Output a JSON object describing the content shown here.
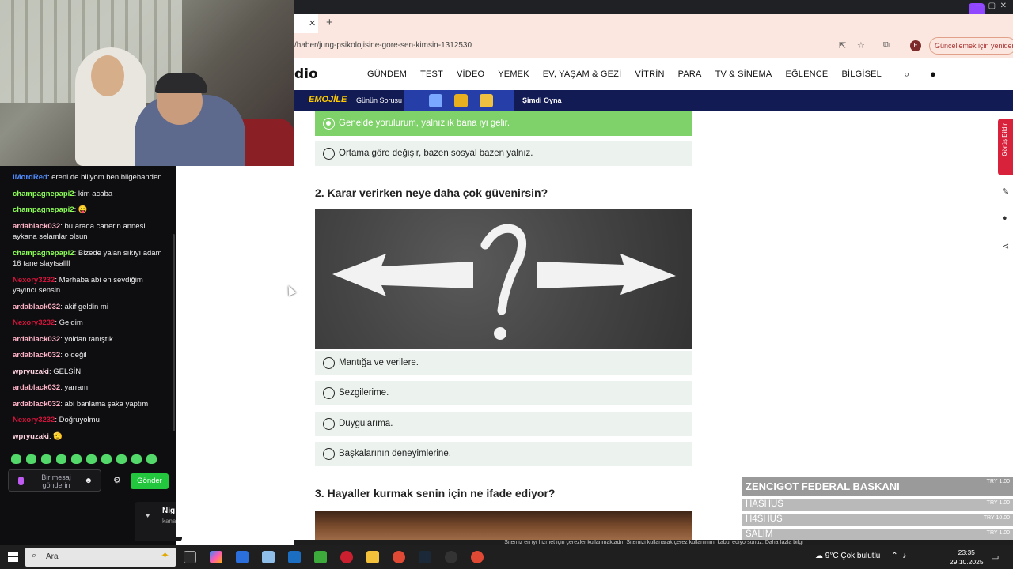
{
  "chat": {
    "messages": [
      {
        "user": "IMordRed",
        "color": "#4f8bff",
        "text": "ereni de biliyom ben bilgehanden"
      },
      {
        "user": "champagnepapi2",
        "color": "#8cff57",
        "text": "kim acaba"
      },
      {
        "user": "champagnepapi2",
        "color": "#8cff57",
        "text": "😛"
      },
      {
        "user": "ardablack032",
        "color": "#ffb3c6",
        "text": "bu arada canerin annesi aykana selamlar olsun"
      },
      {
        "user": "champagnepapi2",
        "color": "#8cff57",
        "text": "Bizede yalan sıkıyı adam 16 tane slaytsallll"
      },
      {
        "user": "Nexory3232",
        "color": "#d4153c",
        "text": "Merhaba abi en sevdiğim yayıncı sensin"
      },
      {
        "user": "ardablack032",
        "color": "#ffb3c6",
        "text": "akif geldin mi"
      },
      {
        "user": "Nexory3232",
        "color": "#d4153c",
        "text": "Geldim"
      },
      {
        "user": "ardablack032",
        "color": "#ffb3c6",
        "text": "yoldan tanıştık"
      },
      {
        "user": "ardablack032",
        "color": "#ffb3c6",
        "text": "o değil"
      },
      {
        "user": "wpryuzaki",
        "color": "#ffd3e0",
        "text": "GELSİN"
      },
      {
        "user": "ardablack032",
        "color": "#ffb3c6",
        "text": "yarram"
      },
      {
        "user": "ardablack032",
        "color": "#ffb3c6",
        "text": "abi banlama şaka yaptım"
      },
      {
        "user": "Nexory3232",
        "color": "#d4153c",
        "text": "Doğruyolmu"
      },
      {
        "user": "wpryuzaki",
        "color": "#ffd3e0",
        "text": "🫡"
      }
    ],
    "input_placeholder": "Bir mesaj gönderin",
    "send_label": "Gönder",
    "notif_title": "Nig",
    "notif_sub": "kana"
  },
  "browser": {
    "url": "/haber/jung-psikolojisine-gore-sen-kimsin-1312530",
    "update_label": "Güncellemek için yeniden başlat",
    "profile_initial": "E"
  },
  "site": {
    "logo": "dio",
    "nav": [
      "GÜNDEM",
      "TEST",
      "VİDEO",
      "YEMEK",
      "EV, YAŞAM & GEZİ",
      "VİTRİN",
      "PARA",
      "TV & SİNEMA",
      "EĞLENCE",
      "BİLGİSEL"
    ],
    "promo_brand": "EMOJİLE",
    "promo_label": "Günün Sorusu",
    "promo_play": "Şimdi Oyna",
    "side_tab": "Görüş Bildir"
  },
  "quiz": {
    "q1_options": [
      {
        "text": "Genelde yorulurum, yalnızlık bana iyi gelir.",
        "selected": true
      },
      {
        "text": "Ortama göre değişir, bazen sosyal bazen yalnız.",
        "selected": false
      }
    ],
    "q2_title": "2. Karar verirken neye daha çok güvenirsin?",
    "q2_options": [
      {
        "text": "Mantığa ve verilere.",
        "selected": false
      },
      {
        "text": "Sezgilerime.",
        "selected": false
      },
      {
        "text": "Duygularıma.",
        "selected": false
      },
      {
        "text": "Başkalarının deneyimlerine.",
        "selected": false
      }
    ],
    "q3_title": "3. Hayaller kurmak senin için ne ifade ediyor?"
  },
  "donations": [
    {
      "name": "ZENCIGOT FEDERAL BASKANI",
      "amount": "TRY 1.00"
    },
    {
      "name": "HASHUS",
      "amount": "TRY 1.00"
    },
    {
      "name": "H4SHUS",
      "amount": "TRY 10.00"
    },
    {
      "name": "SALIM",
      "amount": "TRY 1.00"
    }
  ],
  "cookie_text": "Sitemiz en iyi hizmet için çerezler kullanmaktadır. Sitemizi kullanarak çerez kullanımını kabul ediyorsunuz. Daha fazla bilgi",
  "taskbar": {
    "search_text": "Ara",
    "weather": "9°C  Çok bulutlu",
    "time": "23:35",
    "date": "29.10.2025"
  }
}
